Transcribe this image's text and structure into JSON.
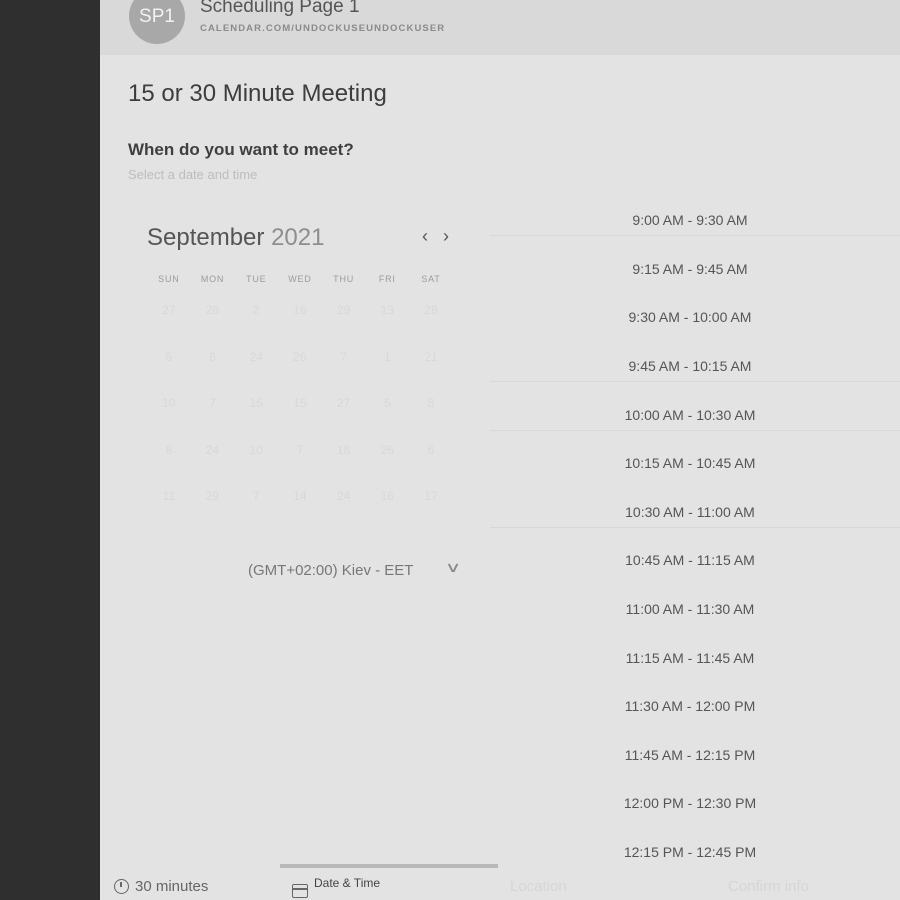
{
  "header": {
    "avatar_initials": "SP1",
    "page_name": "Scheduling Page 1",
    "page_url": "CALENDAR.COM/UNDOCKUSEUNDOCKUSER"
  },
  "meeting": {
    "title": "15 or 30 Minute Meeting",
    "question": "When do you want to meet?",
    "subtitle": "Select a date and time"
  },
  "calendar": {
    "month": "September",
    "year": "2021",
    "prev_icon": "chevron-left-icon",
    "next_icon": "chevron-right-icon",
    "weekdays": [
      "SUN",
      "MON",
      "TUE",
      "WED",
      "THU",
      "FRI",
      "SAT"
    ],
    "weeks": [
      [
        "27",
        "28",
        "2",
        "16",
        "29",
        "13",
        "28"
      ],
      [
        "5",
        "6",
        "24",
        "26",
        "7",
        "1",
        "21"
      ],
      [
        "10",
        "7",
        "15",
        "15",
        "27",
        "5",
        "8"
      ],
      [
        "8",
        "24",
        "10",
        "7",
        "18",
        "26",
        "6"
      ],
      [
        "11",
        "29",
        "7",
        "14",
        "24",
        "16",
        "17"
      ]
    ]
  },
  "timezone": {
    "value": "(GMT+02:00) Kiev - EET",
    "icon": "chevron-down-icon"
  },
  "time_slots": [
    "9:00 AM - 9:30 AM",
    "9:15 AM - 9:45 AM",
    "9:30 AM - 10:00 AM",
    "9:45 AM - 10:15 AM",
    "10:00 AM - 10:30 AM",
    "10:15 AM - 10:45 AM",
    "10:30 AM - 11:00 AM",
    "10:45 AM - 11:15 AM",
    "11:00 AM - 11:30 AM",
    "11:15 AM - 11:45 AM",
    "11:30 AM - 12:00 PM",
    "11:45 AM - 12:15 PM",
    "12:00 PM - 12:30 PM",
    "12:15 PM - 12:45 PM"
  ],
  "footer": {
    "duration_label": "30 minutes",
    "date_time_label": "Date & Time",
    "location_label": "Location",
    "confirm_label": "Confirm info",
    "duration_icon": "clock-icon",
    "date_time_icon": "calendar-icon"
  }
}
